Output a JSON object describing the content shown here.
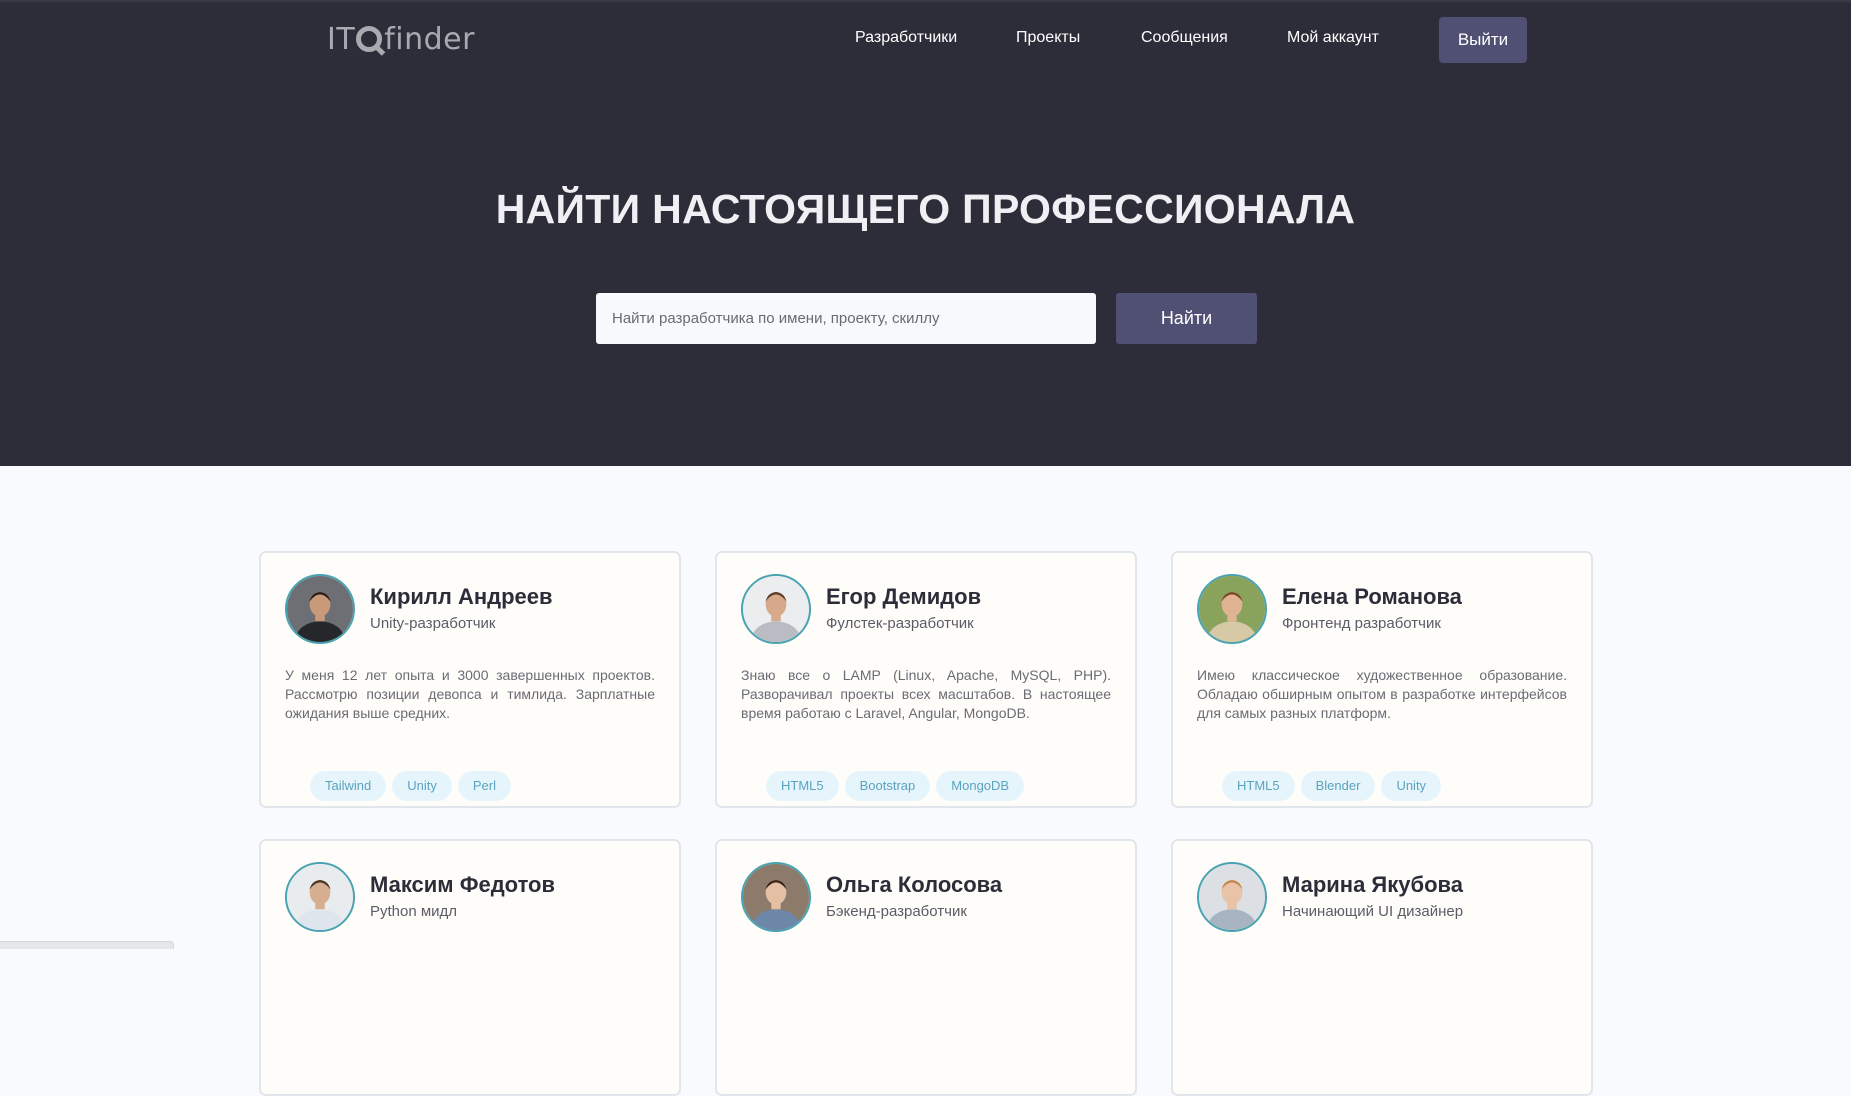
{
  "header": {
    "logo_left": "IT",
    "logo_right": "finder",
    "nav": [
      "Разработчики",
      "Проекты",
      "Сообщения",
      "Мой аккаунт"
    ],
    "logout_label": "Выйти"
  },
  "hero": {
    "title_light": "НАЙТИ НАСТОЯЩЕГО",
    "title_bold": "ПРОФЕССИОНАЛА",
    "search_placeholder": "Найти разработчика по имени, проекту, скиллу",
    "search_button": "Найти"
  },
  "developers": [
    {
      "name": "Кирилл Андреев",
      "role": "Unity-разработчик",
      "description": "У меня 12 лет опыта и 3000 завершенных проектов. Рассмотрю позиции девопса и тимлида. Зарплатные ожидания выше средних.",
      "tags": [
        "Tailwind",
        "Unity",
        "Perl"
      ]
    },
    {
      "name": "Егор Демидов",
      "role": "Фулстек-разработчик",
      "description": "Знаю все о LAMP (Linux, Apache, MySQL, PHP). Разворачивал проекты всех масштабов. В настоящее время работаю с Laravel, Angular, MongoDB.",
      "tags": [
        "HTML5",
        "Bootstrap",
        "MongoDB"
      ]
    },
    {
      "name": "Елена Романова",
      "role": "Фронтенд разработчик",
      "description": "Имею классическое художественное образование. Обладаю обширным опытом в разработке интерфейсов для самых разных платформ.",
      "tags": [
        "HTML5",
        "Blender",
        "Unity"
      ]
    },
    {
      "name": "Максим Федотов",
      "role": "Python мидл",
      "description": "",
      "tags": []
    },
    {
      "name": "Ольга Колосова",
      "role": "Бэкенд-разработчик",
      "description": "",
      "tags": []
    },
    {
      "name": "Марина Якубова",
      "role": "Начинающий UI дизайнер",
      "description": "",
      "tags": []
    }
  ],
  "colors": {
    "hero_bg": "#2d2d39",
    "accent_button": "#505075",
    "avatar_ring": "#4aa3b1",
    "tag_bg": "#e6f5fb",
    "tag_text": "#5aa3bf"
  }
}
